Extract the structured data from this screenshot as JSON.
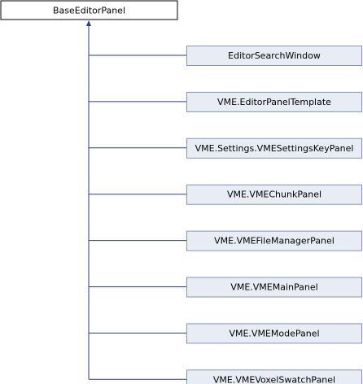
{
  "diagram": {
    "base_class": {
      "label": "BaseEditorPanel"
    },
    "derived_classes": [
      {
        "label": "EditorSearchWindow"
      },
      {
        "label": "VME.EditorPanelTemplate"
      },
      {
        "label": "VME.Settings.VMESettingsKeyPanel"
      },
      {
        "label": "VME.VMEChunkPanel"
      },
      {
        "label": "VME.VMEFileManagerPanel"
      },
      {
        "label": "VME.VMEMainPanel"
      },
      {
        "label": "VME.VMEModePanel"
      },
      {
        "label": "VME.VMEVoxelSwatchPanel"
      }
    ],
    "colors": {
      "base_fill": "#ffffff",
      "base_stroke": "#000000",
      "derived_fill": "#e8edf5",
      "derived_stroke": "#8594b8",
      "edge": "#2b3a8f"
    }
  }
}
